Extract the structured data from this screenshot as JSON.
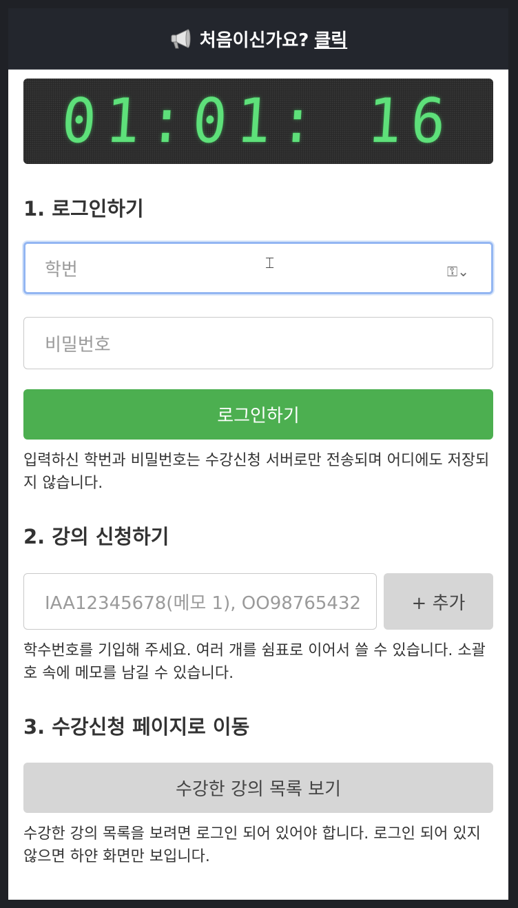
{
  "topbar": {
    "icon": "megaphone-icon",
    "text": "처음이신가요?",
    "link": "클릭"
  },
  "clock": {
    "time": "01:01: 16",
    "color": "#5ee07a"
  },
  "login": {
    "title": "1. 로그인하기",
    "student_id_placeholder": "학번",
    "password_placeholder": "비밀번호",
    "button": "로그인하기",
    "note": "입력하신 학번과 비밀번호는 수강신청 서버로만 전송되며 어디에도 저장되지 않습니다."
  },
  "apply": {
    "title": "2. 강의 신청하기",
    "input_placeholder": "IAA12345678(메모 1), OO98765432",
    "add_button": "+ 추가",
    "note": "학수번호를 기입해 주세요. 여러 개를 쉼표로 이어서 쓸 수 있습니다. 소괄호 속에 메모를 남길 수 있습니다."
  },
  "move": {
    "title": "3. 수강신청 페이지로 이동",
    "button": "수강한 강의 목록 보기",
    "note": "수강한 강의 목록을 보려면 로그인 되어 있어야 합니다. 로그인 되어 있지 않으면 하얀 화면만 보입니다."
  },
  "colors": {
    "primary": "#4caf50",
    "topbar": "#23262d",
    "focus": "#93b6f2"
  }
}
